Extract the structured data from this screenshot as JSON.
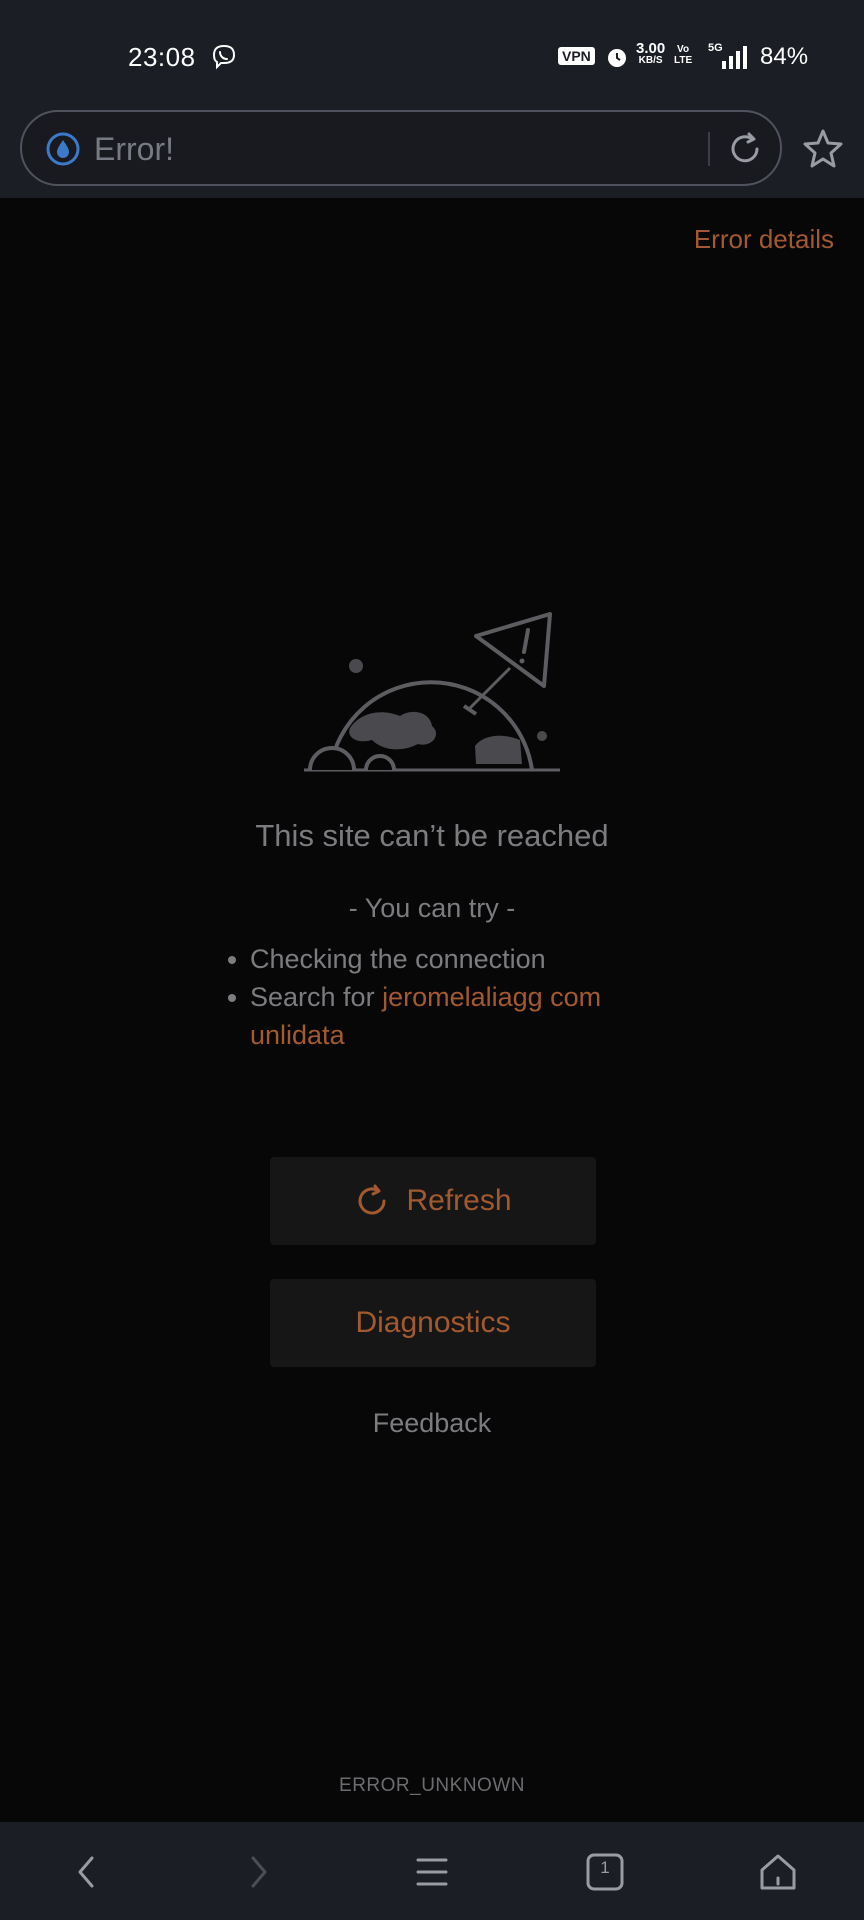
{
  "status_bar": {
    "time": "23:08",
    "vpn": "VPN",
    "net_speed_value": "3.00",
    "net_speed_unit": "KB/S",
    "volte_top": "Vo",
    "volte_bottom": "LTE",
    "network": "5G",
    "battery": "84%"
  },
  "toolbar": {
    "url_text": "Error!",
    "icons": [
      "site-info-icon",
      "reload-icon",
      "bookmark-star-icon"
    ]
  },
  "error_page": {
    "error_details_link": "Error details",
    "title": "This site can’t be reached",
    "try_heading": "- You can try -",
    "suggestion_1": "Checking the connection",
    "suggestion_2_prefix": "Search for",
    "suggestion_2_query": "jeromelaliagg com unlidata",
    "refresh_label": "Refresh",
    "diagnostics_label": "Diagnostics",
    "feedback_label": "Feedback",
    "error_code": "ERROR_UNKNOWN"
  },
  "nav_bar": {
    "tab_count": "1",
    "icons": [
      "back-icon",
      "forward-icon",
      "menu-icon",
      "tabs-icon",
      "home-icon"
    ]
  },
  "colors": {
    "accent": "#a3592f",
    "background": "#070707",
    "chrome": "#1c1e25",
    "muted_text": "#7c7c80"
  }
}
